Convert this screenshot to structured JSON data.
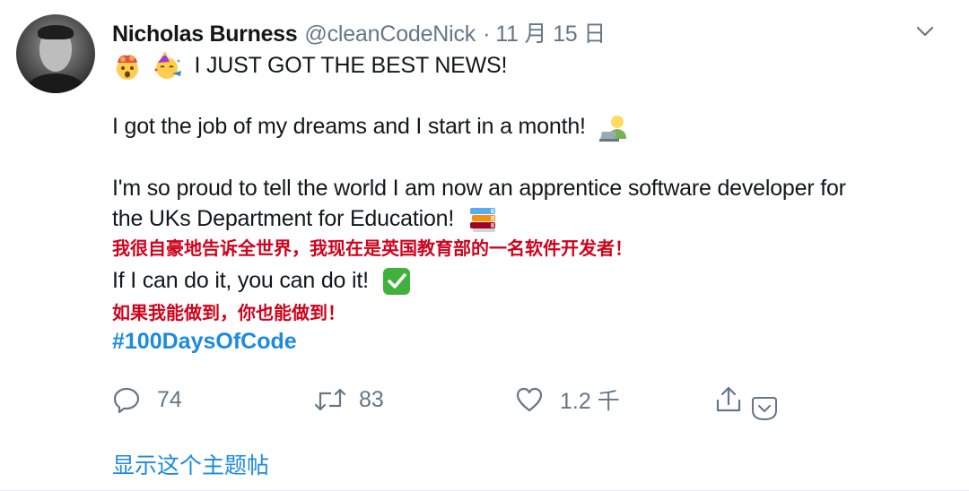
{
  "tweet": {
    "author_name": "Nicholas Burness",
    "handle": "@cleanCodeNick",
    "separator": "·",
    "date": "11 月 15 日",
    "lines": {
      "l1": "I JUST GOT THE BEST NEWS!",
      "l2": "I got the job of my dreams and I start in a month!",
      "l3": "I'm so proud to tell the world I am now an apprentice software developer for",
      "l4": "the UKs Department for Education!",
      "l5": "If I can do it, you can do it!"
    },
    "translations": {
      "t1": "我很自豪地告诉全世界，我现在是英国教育部的一名软件开发者！",
      "t2": "如果我能做到，你也能做到！"
    },
    "hashtag": "#100DaysOfCode",
    "actions": {
      "replies": "74",
      "retweets": "83",
      "likes": "1.2 千"
    },
    "show_thread": "显示这个主题帖"
  },
  "icons": {
    "menu": "chevron-down-icon",
    "reply": "reply-icon",
    "retweet": "retweet-icon",
    "like": "heart-icon",
    "share": "share-icon",
    "dropdown": "chevron-down-circle-icon"
  },
  "colors": {
    "text": "#14171a",
    "muted": "#657786",
    "link": "#1b8be0",
    "annotation": "#d0021b",
    "check": "#40b13c"
  }
}
